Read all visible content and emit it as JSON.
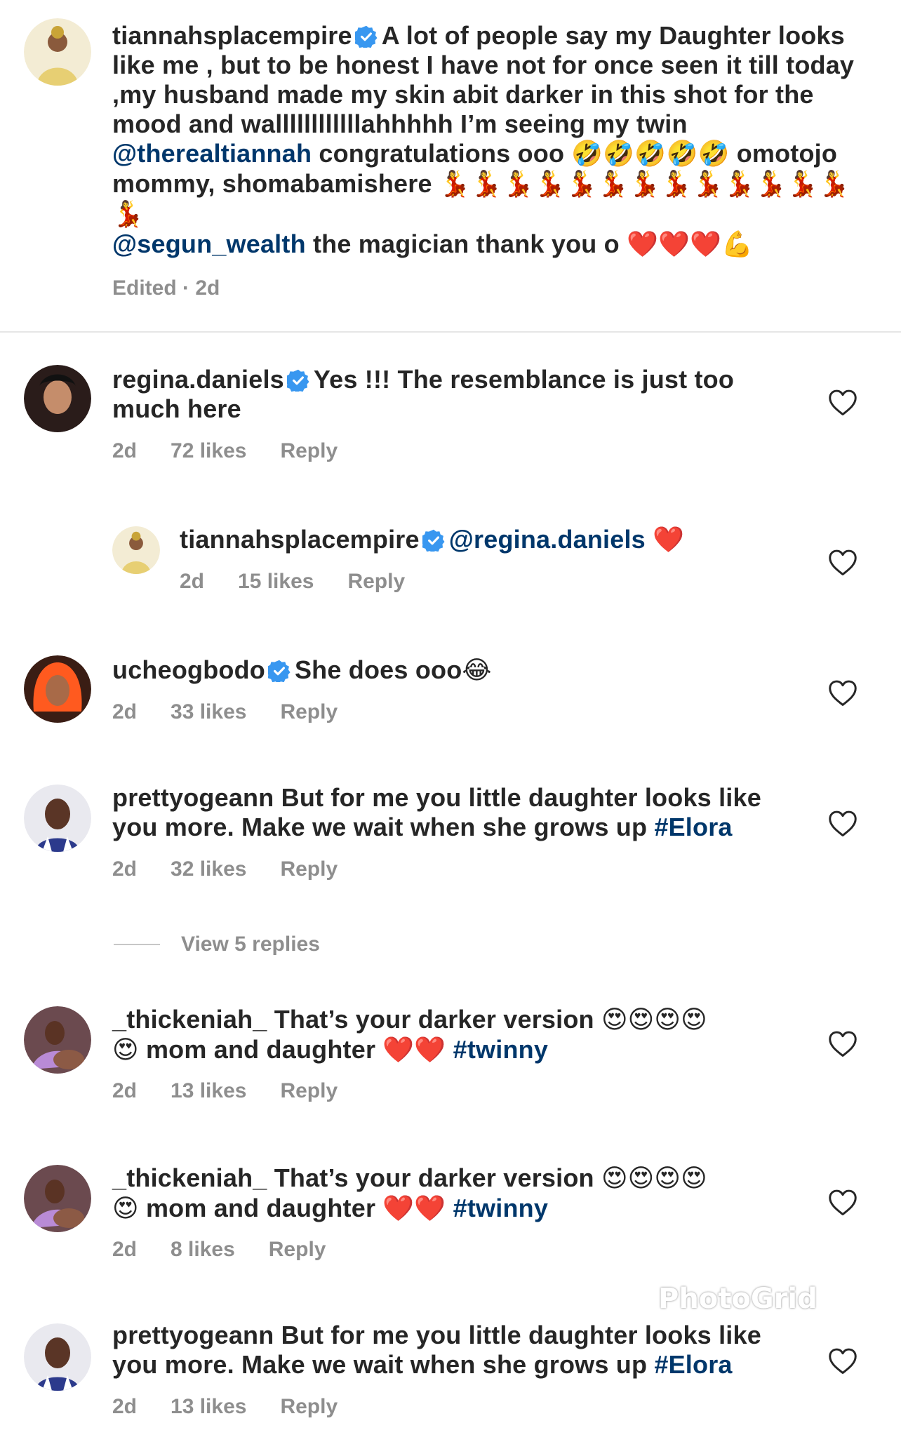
{
  "caption": {
    "username": "tiannahsplacempire",
    "text_part1": "A lot of people say my Daughter looks like me , but to be honest I have not for once seen it till today ,my husband made my skin abit darker in this shot for the mood and wallllllllllllahhhhh I’m seeing my twin",
    "mention1": "@therealtiannah",
    "text_part2": "congratulations ooo",
    "emoji_laugh": "🤣🤣🤣🤣🤣",
    "text_part3": "omotojo mommy, shomabamishere",
    "emoji_dancer": "💃💃💃💃💃💃💃💃💃💃💃💃💃💃",
    "mention2": "@segun_wealth",
    "text_part4": "the magician thank you o",
    "emoji_end": "❤️❤️❤️💪",
    "meta": "Edited · 2d"
  },
  "comments": [
    {
      "username": "regina.daniels",
      "text": "Yes !!! The resemblance is just too much here",
      "time": "2d",
      "likes": "72 likes",
      "reply": "Reply"
    },
    {
      "username": "tiannahsplacempire",
      "mention": "@regina.daniels",
      "emoji": "❤️",
      "time": "2d",
      "likes": "15 likes",
      "reply": "Reply"
    },
    {
      "username": "ucheogbodo",
      "text": "She does ooo",
      "emoji": "😂",
      "time": "2d",
      "likes": "33 likes",
      "reply": "Reply"
    },
    {
      "username": "prettyogeann",
      "text": "But for me you little daughter looks like you more. Make we wait when she grows up",
      "tag": "#Elora",
      "time": "2d",
      "likes": "32 likes",
      "reply": "Reply"
    },
    {
      "username": "_thickeniah_",
      "text": "That’s your darker version",
      "emoji_eyes": "😍😍😍😍",
      "emoji_eyes2": "😍",
      "text2": "mom and daughter",
      "emoji_hearts": "❤️❤️",
      "tag": "#twinny",
      "time": "2d",
      "likes": "13 likes",
      "reply": "Reply"
    },
    {
      "username": "_thickeniah_",
      "text": "That’s your darker version",
      "emoji_eyes": "😍😍😍😍",
      "emoji_eyes2": "😍",
      "text2": "mom and daughter",
      "emoji_hearts": "❤️❤️",
      "tag": "#twinny",
      "time": "2d",
      "likes": "8 likes",
      "reply": "Reply"
    },
    {
      "username": "prettyogeann",
      "text": "But for me you little daughter looks like you more. Make we wait when she grows up",
      "tag": "#Elora",
      "time": "2d",
      "likes": "13 likes",
      "reply": "Reply"
    }
  ],
  "view_replies": "View 5 replies",
  "watermark": "PhotoGrid",
  "colors": {
    "link": "#00376b",
    "muted": "#8e8e8e",
    "verified": "#3897f0"
  },
  "icons": [
    "verified-badge-icon",
    "heart-outline-icon",
    "avatar"
  ]
}
